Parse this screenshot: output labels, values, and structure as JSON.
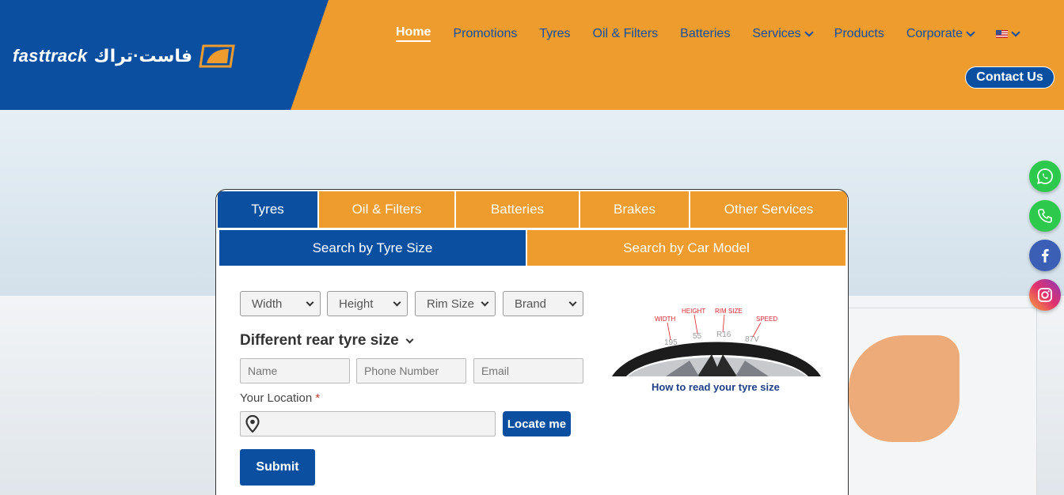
{
  "brand": {
    "name_en": "fasttrack",
    "name_ar": "فاست·تراك"
  },
  "nav": {
    "items": [
      {
        "label": "Home",
        "active": true,
        "dropdown": false
      },
      {
        "label": "Promotions",
        "active": false,
        "dropdown": false
      },
      {
        "label": "Tyres",
        "active": false,
        "dropdown": false
      },
      {
        "label": "Oil & Filters",
        "active": false,
        "dropdown": false
      },
      {
        "label": "Batteries",
        "active": false,
        "dropdown": false
      },
      {
        "label": "Services",
        "active": false,
        "dropdown": true
      },
      {
        "label": "Products",
        "active": false,
        "dropdown": false
      },
      {
        "label": "Corporate",
        "active": false,
        "dropdown": true
      }
    ],
    "language_icon": "us-flag-icon",
    "contact_label": "Contact Us"
  },
  "search": {
    "category_tabs": [
      "Tyres",
      "Oil & Filters",
      "Batteries",
      "Brakes",
      "Other Services"
    ],
    "active_category": "Tyres",
    "mode_tabs": [
      "Search by Tyre Size",
      "Search by Car Model"
    ],
    "active_mode": "Search by Tyre Size",
    "selects": [
      "Width",
      "Height",
      "Rim Size",
      "Brand"
    ],
    "rear_toggle": "Different rear tyre size",
    "placeholders": {
      "name": "Name",
      "phone": "Phone Number",
      "email": "Email"
    },
    "location_label": "Your Location",
    "required_mark": "*",
    "locate_label": "Locate me",
    "submit_label": "Submit",
    "tyre_figure": {
      "labels": [
        "WIDTH",
        "HEIGHT",
        "RIM SIZE",
        "SPEED"
      ],
      "sidewall": [
        "195",
        "55",
        "R16",
        "87V"
      ],
      "caption": "How to read your tyre size"
    }
  },
  "colors": {
    "brand_blue": "#0b4fa0",
    "brand_orange": "#ef9c2f"
  },
  "social": [
    "whatsapp-icon",
    "phone-icon",
    "facebook-icon",
    "instagram-icon"
  ]
}
